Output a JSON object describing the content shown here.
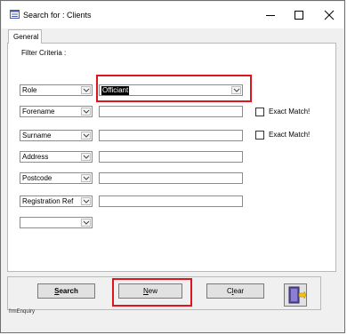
{
  "window": {
    "title": "Search for : Clients",
    "controls": {
      "minimize": "—",
      "maximize": "☐",
      "close": "✕"
    }
  },
  "tabs": [
    {
      "label": "General",
      "active": true
    }
  ],
  "filter": {
    "heading": "Filter Criteria :",
    "rows": [
      {
        "field": "Role",
        "value": "Officiant",
        "value_control": "combo",
        "value_selected": true
      },
      {
        "field": "Forename",
        "value": "",
        "exact_match_label": "Exact Match!"
      },
      {
        "field": "Surname",
        "value": "",
        "exact_match_label": "Exact Match!"
      },
      {
        "field": "Address",
        "value": ""
      },
      {
        "field": "Postcode",
        "value": ""
      },
      {
        "field": "Registration Ref",
        "value": ""
      },
      {
        "field": "",
        "value": ""
      }
    ]
  },
  "buttons": {
    "search": {
      "label": "Search",
      "accel": "S"
    },
    "new": {
      "label": "New",
      "accel": "N"
    },
    "clear": {
      "label": "Clear",
      "accel": "l"
    },
    "exit_icon": "exit-door-icon"
  },
  "form_name": "frmEnquiry",
  "colors": {
    "highlight": "#e0141c",
    "selection_bg": "#000000",
    "selection_fg": "#ffffff"
  }
}
